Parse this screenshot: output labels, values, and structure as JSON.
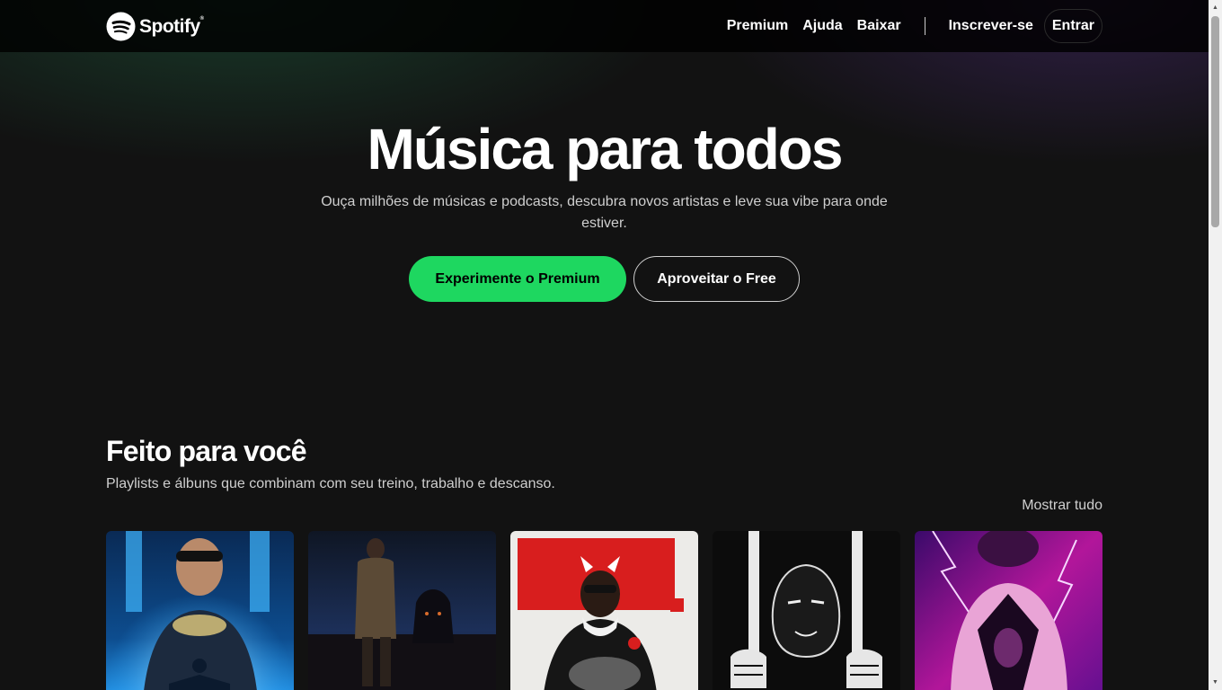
{
  "brand": {
    "name": "Spotify",
    "mark": "®"
  },
  "nav": {
    "links": [
      "Premium",
      "Ajuda",
      "Baixar"
    ],
    "signup": "Inscrever-se",
    "login": "Entrar"
  },
  "hero": {
    "title": "Música para todos",
    "subtitle": "Ouça milhões de músicas e podcasts, descubra novos artistas e leve sua vibe para onde estiver.",
    "primary_cta": "Experimente o Premium",
    "secondary_cta": "Aproveitar o Free"
  },
  "section": {
    "title": "Feito para você",
    "subtitle": "Playlists e álbuns que combinam com seu treino, trabalho e descanso.",
    "show_all": "Mostrar tudo"
  },
  "colors": {
    "accent": "#1ed760",
    "background": "#121212"
  }
}
